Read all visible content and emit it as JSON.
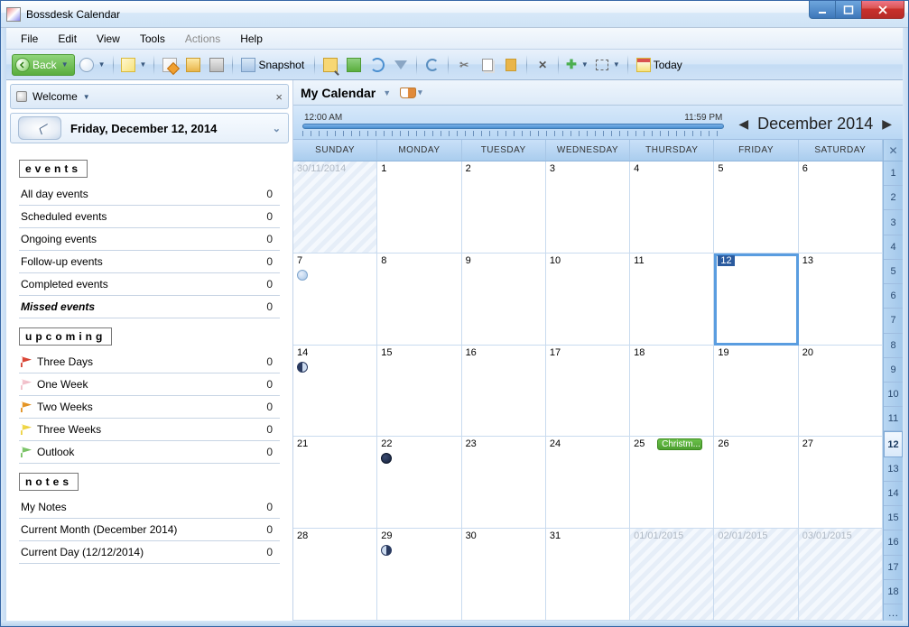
{
  "title": "Bossdesk Calendar",
  "menu": {
    "file": "File",
    "edit": "Edit",
    "view": "View",
    "tools": "Tools",
    "actions": "Actions",
    "help": "Help"
  },
  "toolbar": {
    "back": "Back",
    "snapshot": "Snapshot",
    "today": "Today"
  },
  "sidebar": {
    "welcome": "Welcome",
    "date": "Friday, December 12, 2014",
    "events_title": "events",
    "events": [
      {
        "label": "All day events",
        "count": "0"
      },
      {
        "label": "Scheduled events",
        "count": "0"
      },
      {
        "label": "Ongoing events",
        "count": "0"
      },
      {
        "label": "Follow-up events",
        "count": "0"
      },
      {
        "label": "Completed events",
        "count": "0"
      },
      {
        "label": "Missed events",
        "count": "0",
        "italic": true
      }
    ],
    "upcoming_title": "upcoming",
    "upcoming": [
      {
        "label": "Three Days",
        "count": "0",
        "flag": "red"
      },
      {
        "label": "One Week",
        "count": "0",
        "flag": "pink"
      },
      {
        "label": "Two Weeks",
        "count": "0",
        "flag": "orange"
      },
      {
        "label": "Three Weeks",
        "count": "0",
        "flag": "yellow"
      },
      {
        "label": "Outlook",
        "count": "0",
        "flag": "green"
      }
    ],
    "notes_title": "notes",
    "notes": [
      {
        "label": "My Notes",
        "count": "0"
      },
      {
        "label": "Current Month (December 2014)",
        "count": "0"
      },
      {
        "label": "Current Day (12/12/2014)",
        "count": "0"
      }
    ]
  },
  "calendar": {
    "title": "My Calendar",
    "time_start": "12:00 AM",
    "time_end": "11:59 PM",
    "month": "December 2014",
    "dow": [
      "SUNDAY",
      "MONDAY",
      "TUESDAY",
      "WEDNESDAY",
      "THURSDAY",
      "FRIDAY",
      "SATURDAY"
    ],
    "weeks": [
      "1",
      "2",
      "3",
      "4",
      "5",
      "6",
      "7",
      "8",
      "9",
      "10",
      "11",
      "12",
      "13",
      "14",
      "15",
      "16",
      "17",
      "18"
    ],
    "cells": [
      {
        "n": "30/11/2014",
        "other": true
      },
      {
        "n": "1"
      },
      {
        "n": "2"
      },
      {
        "n": "3"
      },
      {
        "n": "4"
      },
      {
        "n": "5"
      },
      {
        "n": "6"
      },
      {
        "n": "7",
        "moon": "full"
      },
      {
        "n": "8"
      },
      {
        "n": "9"
      },
      {
        "n": "10"
      },
      {
        "n": "11"
      },
      {
        "n": "12",
        "today": true
      },
      {
        "n": "13"
      },
      {
        "n": "14",
        "moon": "lq"
      },
      {
        "n": "15"
      },
      {
        "n": "16"
      },
      {
        "n": "17"
      },
      {
        "n": "18"
      },
      {
        "n": "19"
      },
      {
        "n": "20"
      },
      {
        "n": "21"
      },
      {
        "n": "22",
        "moon": "new"
      },
      {
        "n": "23"
      },
      {
        "n": "24"
      },
      {
        "n": "25",
        "event": "Christm..."
      },
      {
        "n": "26"
      },
      {
        "n": "27"
      },
      {
        "n": "28"
      },
      {
        "n": "29",
        "moon": "fq"
      },
      {
        "n": "30"
      },
      {
        "n": "31"
      },
      {
        "n": "01/01/2015",
        "other": true
      },
      {
        "n": "02/01/2015",
        "other": true
      },
      {
        "n": "03/01/2015",
        "other": true
      }
    ]
  }
}
